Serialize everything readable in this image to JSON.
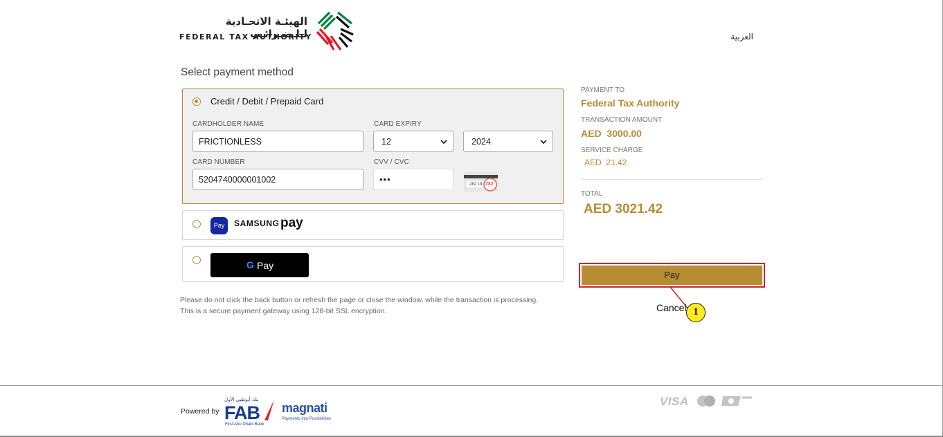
{
  "header": {
    "org_name_ar": "الهيئـة الاتحـادية لـلـضـرائـب",
    "org_name_en": "FEDERAL TAX AUTHORITY",
    "language_link": "العربية",
    "brand_colors": [
      "#00843d",
      "#e31b23",
      "#111111"
    ]
  },
  "page": {
    "section_title": "Select payment method"
  },
  "card_method": {
    "label": "Credit / Debit / Prepaid Card",
    "selected": true,
    "cardholder_label": "CARDHOLDER NAME",
    "cardholder_value": "FRICTIONLESS",
    "expiry_label": "CARD EXPIRY",
    "expiry_month": "12",
    "expiry_year": "2024",
    "number_label": "CARD NUMBER",
    "number_value": "5204740000001002",
    "cvv_label": "CVV / CVC",
    "cvv_value": "•••",
    "cvv_hint_digits": "282 19",
    "cvv_hint_code": "782"
  },
  "samsung_pay": {
    "badge": "Pay",
    "brand": "SAMSUNG",
    "pay": "pay",
    "icon": "samsung-pay-icon"
  },
  "google_pay": {
    "g": "G",
    "label": "Pay",
    "icon": "google-pay-icon"
  },
  "notes": {
    "line1": "Please do not click the back button or refresh the page or close the window, while the transaction is processing.",
    "line2": "This is a secure payment gateway using 128-bit SSL encryption."
  },
  "summary": {
    "payment_to_label": "PAYMENT TO",
    "payment_to_value": "Federal Tax Authority",
    "transaction_label": "TRANSACTION AMOUNT",
    "transaction_value": "AED  3000.00",
    "service_label": "SERVICE CHARGE",
    "service_value": "AED  21.42",
    "total_label": "TOTAL",
    "total_value": "AED 3021.42",
    "accent_color": "#b88c33"
  },
  "actions": {
    "pay_label": "Pay",
    "cancel_label": "Cancel",
    "callout_number": "1",
    "highlight_color": "#d81e2a"
  },
  "footer": {
    "powered_by": "Powered by",
    "fab_arabic": "بنك أبوظبي الأول",
    "fab_logo": "FAB",
    "fab_subtitle": "First Abu Dhabi Bank",
    "magnati": "magnati",
    "magnati_tagline": "Payments into Possibilities",
    "visa": "VISA",
    "mastercard_icon": "mastercard-icon",
    "pci_icon": "pci-dss-icon"
  }
}
